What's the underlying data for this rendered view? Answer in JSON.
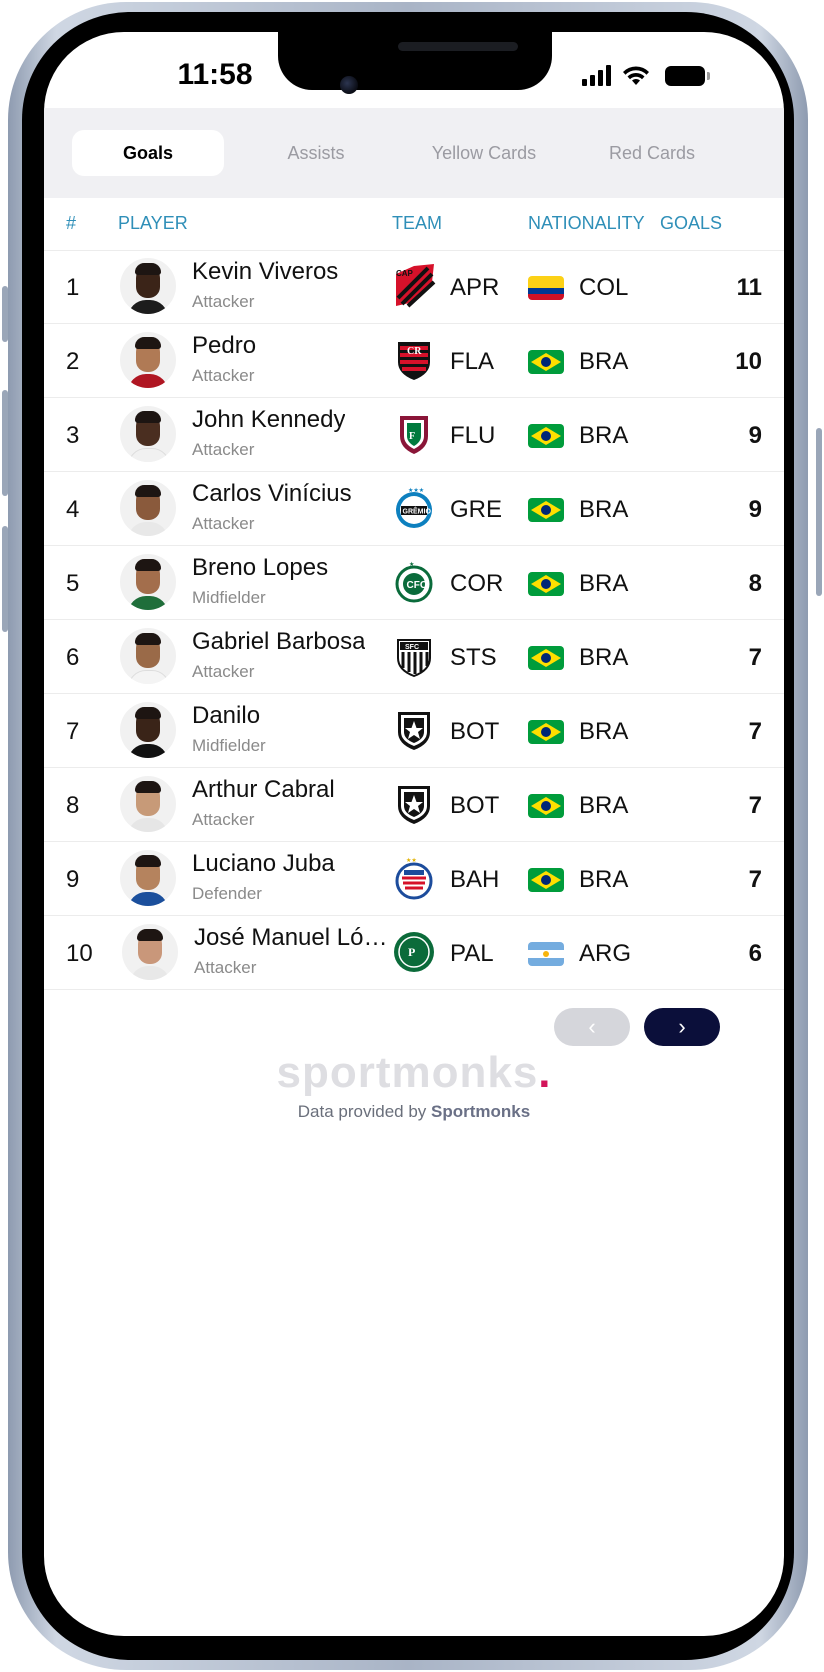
{
  "status_bar": {
    "time": "11:58"
  },
  "tabs": [
    {
      "label": "Goals",
      "active": true
    },
    {
      "label": "Assists",
      "active": false
    },
    {
      "label": "Yellow Cards",
      "active": false
    },
    {
      "label": "Red Cards",
      "active": false
    }
  ],
  "table": {
    "headers": {
      "rank": "#",
      "player": "PLAYER",
      "team": "TEAM",
      "nationality": "NATIONALITY",
      "goals": "GOALS"
    },
    "rows": [
      {
        "rank": "1",
        "name": "Kevin Viveros",
        "position": "Attacker",
        "team": "APR",
        "nationality": "COL",
        "goals": "11"
      },
      {
        "rank": "2",
        "name": "Pedro",
        "position": "Attacker",
        "team": "FLA",
        "nationality": "BRA",
        "goals": "10"
      },
      {
        "rank": "3",
        "name": "John Kennedy",
        "position": "Attacker",
        "team": "FLU",
        "nationality": "BRA",
        "goals": "9"
      },
      {
        "rank": "4",
        "name": "Carlos Vinícius",
        "position": "Attacker",
        "team": "GRE",
        "nationality": "BRA",
        "goals": "9"
      },
      {
        "rank": "5",
        "name": "Breno Lopes",
        "position": "Midfielder",
        "team": "COR",
        "nationality": "BRA",
        "goals": "8"
      },
      {
        "rank": "6",
        "name": "Gabriel Barbosa",
        "position": "Attacker",
        "team": "STS",
        "nationality": "BRA",
        "goals": "7"
      },
      {
        "rank": "7",
        "name": "Danilo",
        "position": "Midfielder",
        "team": "BOT",
        "nationality": "BRA",
        "goals": "7"
      },
      {
        "rank": "8",
        "name": "Arthur Cabral",
        "position": "Attacker",
        "team": "BOT",
        "nationality": "BRA",
        "goals": "7"
      },
      {
        "rank": "9",
        "name": "Luciano Juba",
        "position": "Defender",
        "team": "BAH",
        "nationality": "BRA",
        "goals": "7"
      },
      {
        "rank": "10",
        "name": "José Manuel Ló…",
        "position": "Attacker",
        "team": "PAL",
        "nationality": "ARG",
        "goals": "6"
      }
    ]
  },
  "pagination": {
    "prev_icon": "chevron-left-icon",
    "next_icon": "chevron-right-icon"
  },
  "footer": {
    "logo_text": "sportmonks",
    "logo_dot": ".",
    "credit_prefix": "Data provided by",
    "credit_brand": "Sportmonks"
  },
  "colors": {
    "header_text": "#2f8fb8",
    "pager_next": "#0b0f3a",
    "pager_prev": "#d5d6db",
    "brand_dot": "#d2145a"
  }
}
